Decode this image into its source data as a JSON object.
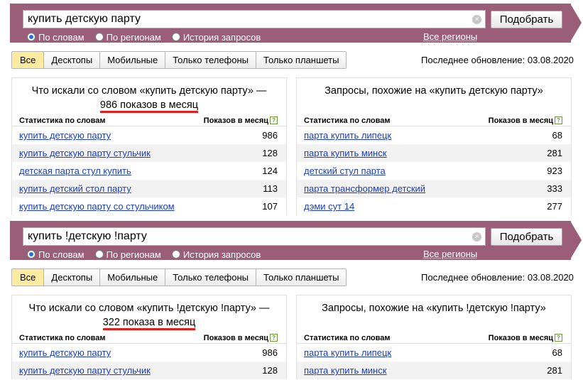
{
  "blocks": [
    {
      "search": {
        "query": "купить детскую парту",
        "clear_glyph": "×",
        "button": "Подобрать",
        "radios": [
          {
            "label": "По словам",
            "checked": true
          },
          {
            "label": "По регионам",
            "checked": false
          },
          {
            "label": "История запросов",
            "checked": false
          }
        ],
        "regions_link": "Все регионы"
      },
      "tabs": [
        "Все",
        "Десктопы",
        "Мобильные",
        "Только телефоны",
        "Только планшеты"
      ],
      "active_tab": 0,
      "updated": "Последнее обновление: 03.08.2020",
      "left": {
        "title_prefix": "Что искали со словом «купить детскую парту» — ",
        "title_shows": "986 показов в месяц",
        "col_words": "Статистика по словам",
        "col_shows": "Показов в месяц",
        "help_glyph": "?",
        "rows": [
          {
            "phrase": "купить детскую парту",
            "count": "986"
          },
          {
            "phrase": "купить детскую парту стульчик",
            "count": "128"
          },
          {
            "phrase": "детская парта стул купить",
            "count": "124"
          },
          {
            "phrase": "купить детский стол парту",
            "count": "113"
          },
          {
            "phrase": "купить детскую парту со стульчиком",
            "count": "107"
          }
        ]
      },
      "right": {
        "title": "Запросы, похожие на «купить детскую парту»",
        "col_words": "Статистика по словам",
        "col_shows": "Показов в месяц",
        "help_glyph": "?",
        "rows": [
          {
            "phrase": "парта купить липецк",
            "count": "68"
          },
          {
            "phrase": "парта купить минск",
            "count": "281"
          },
          {
            "phrase": "детский стул парта",
            "count": "923"
          },
          {
            "phrase": "парта трансформер детский",
            "count": "333"
          },
          {
            "phrase": "дэми сут 14",
            "count": "277"
          }
        ]
      }
    },
    {
      "search": {
        "query": "купить !детскую !парту",
        "clear_glyph": "×",
        "button": "Подобрать",
        "radios": [
          {
            "label": "По словам",
            "checked": true
          },
          {
            "label": "По регионам",
            "checked": false
          },
          {
            "label": "История запросов",
            "checked": false
          }
        ],
        "regions_link": "Все регионы"
      },
      "tabs": [
        "Все",
        "Десктопы",
        "Мобильные",
        "Только телефоны",
        "Только планшеты"
      ],
      "active_tab": 0,
      "updated": "Последнее обновление: 03.08.2020",
      "left": {
        "title_prefix": "Что искали со словом «купить !детскую !парту» — ",
        "title_shows": "322 показа в месяц",
        "col_words": "Статистика по словам",
        "col_shows": "Показов в месяц",
        "help_glyph": "?",
        "rows": [
          {
            "phrase": "купить детскую парту",
            "count": "986"
          },
          {
            "phrase": "купить детскую парту стульчик",
            "count": "128"
          }
        ]
      },
      "right": {
        "title": "Запросы, похожие на «купить !детскую !парту»",
        "col_words": "Статистика по словам",
        "col_shows": "Показов в месяц",
        "help_glyph": "?",
        "rows": [
          {
            "phrase": "парта купить липецк",
            "count": "68"
          },
          {
            "phrase": "парта купить минск",
            "count": "281"
          }
        ]
      }
    }
  ],
  "colors": {
    "bar": "#9b5e79",
    "link": "#1a3dc1",
    "accent_underline": "#e01e1e",
    "active_tab": "#ffeba0"
  }
}
